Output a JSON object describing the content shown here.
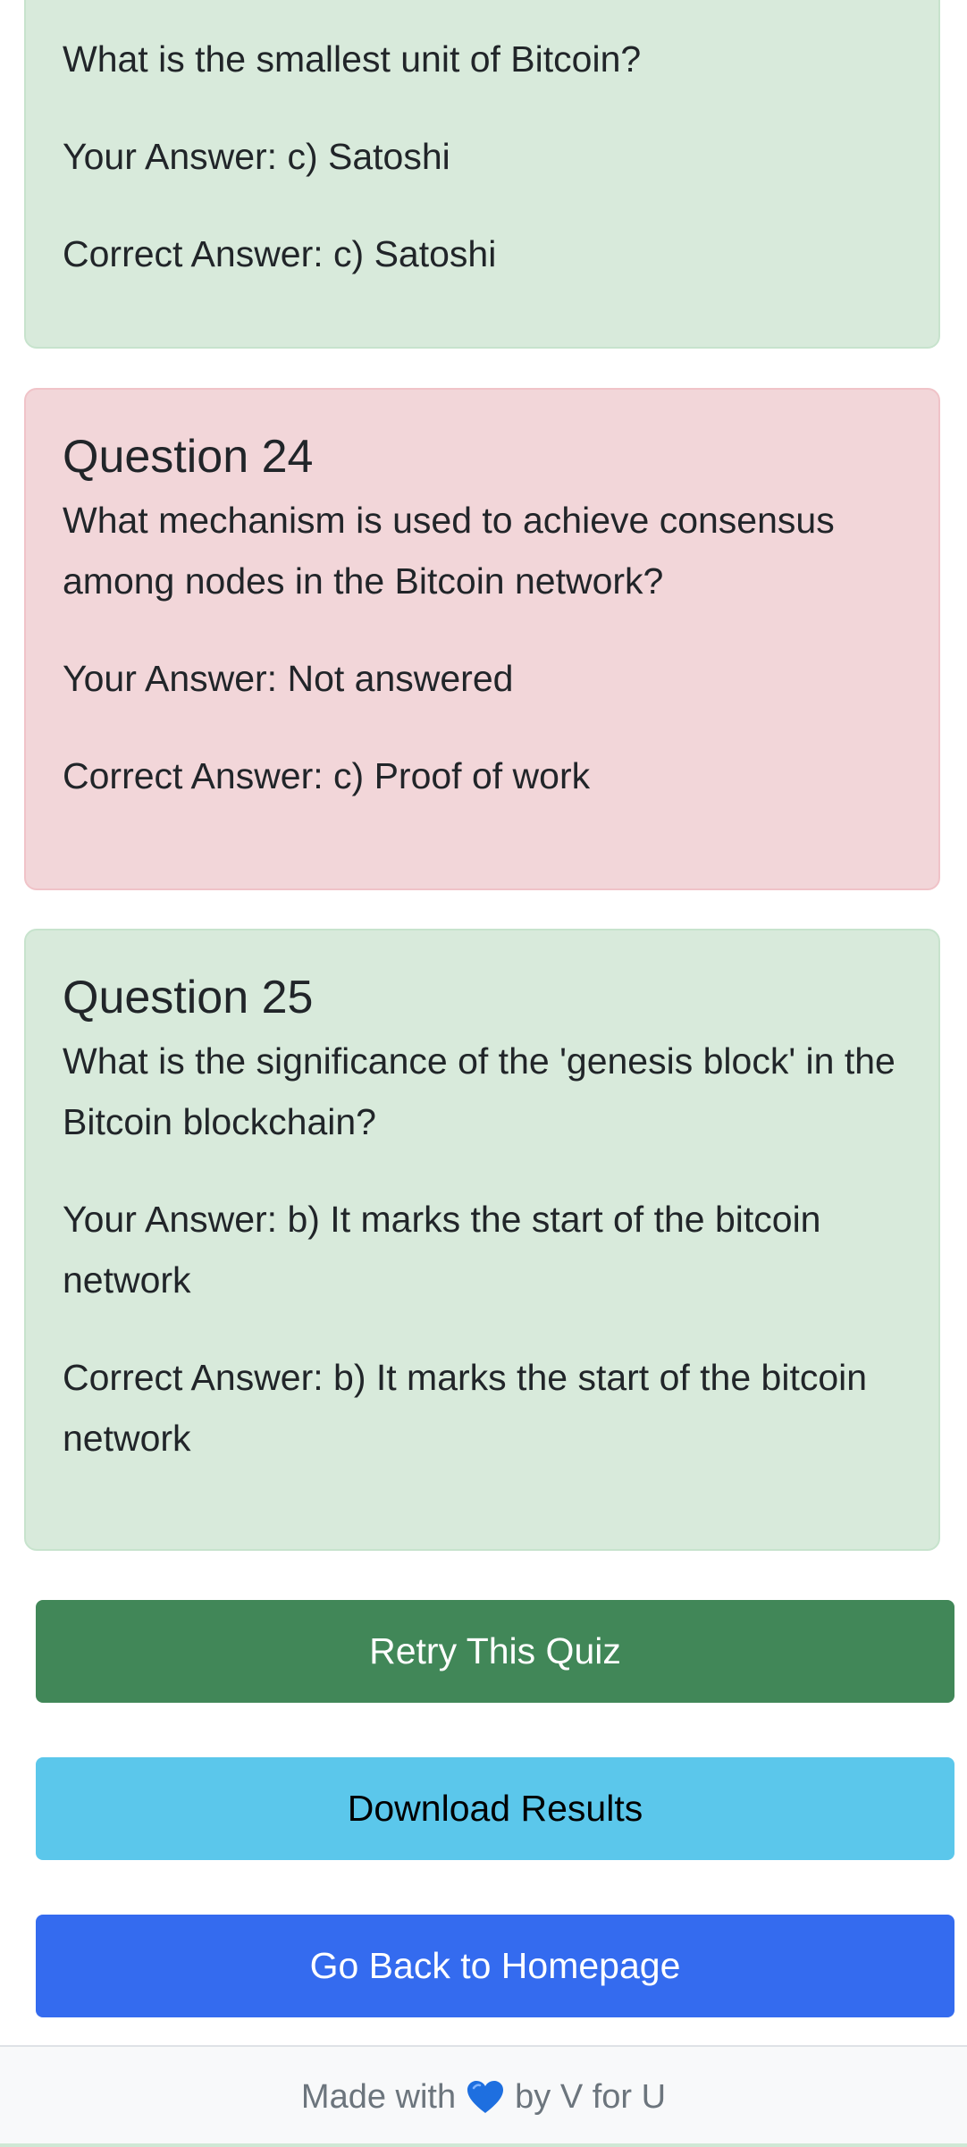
{
  "cards": [
    {
      "status": "correct",
      "question": "What is the smallest unit of Bitcoin?",
      "your_answer": "Your Answer: c) Satoshi",
      "correct_answer": "Correct Answer: c) Satoshi"
    },
    {
      "status": "wrong",
      "title": "Question 24",
      "question": "What mechanism is used to achieve consensus among nodes in the Bitcoin network?",
      "your_answer": "Your Answer: Not answered",
      "correct_answer": "Correct Answer: c) Proof of work"
    },
    {
      "status": "correct",
      "title": "Question 25",
      "question": "What is the significance of the 'genesis block' in the Bitcoin blockchain?",
      "your_answer": "Your Answer: b) It marks the start of the bitcoin network",
      "correct_answer": "Correct Answer: b) It marks the start of the bitcoin network"
    }
  ],
  "buttons": {
    "retry": "Retry This Quiz",
    "download": "Download Results",
    "home": "Go Back to Homepage"
  },
  "footer": {
    "before": "Made with",
    "icon": "blue-heart-icon",
    "after": "by V for U"
  },
  "colors": {
    "correct_bg": "#d8eadb",
    "wrong_bg": "#f2d6d9",
    "retry": "#418758",
    "download": "#5bc7eb",
    "home": "#346bef",
    "heart": "#1e6fe0"
  }
}
